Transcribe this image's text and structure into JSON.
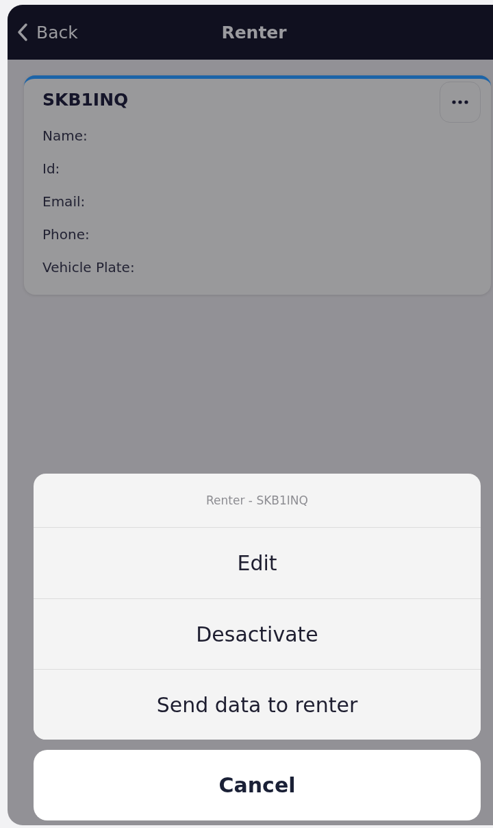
{
  "header": {
    "back_label": "Back",
    "title": "Renter"
  },
  "renter_card": {
    "plate": "SKB1INQ",
    "fields": [
      "Name:",
      "Id:",
      "Email:",
      "Phone:",
      "Vehicle Plate:"
    ]
  },
  "action_sheet": {
    "title": "Renter - SKB1INQ",
    "actions": [
      "Edit",
      "Desactivate",
      "Send data to renter"
    ],
    "cancel_label": "Cancel"
  }
}
